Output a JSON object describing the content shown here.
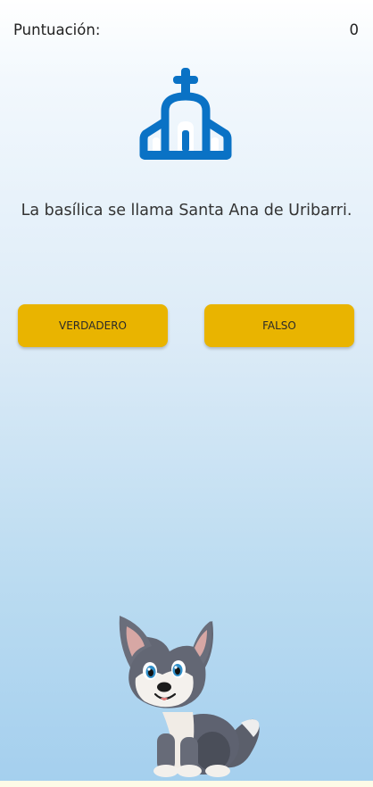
{
  "score": {
    "label": "Puntuación:",
    "value": "0"
  },
  "question": {
    "icon": "church-icon",
    "text": "La basílica se llama Santa Ana de Uribarri."
  },
  "answers": {
    "true_label": "VERDADERO",
    "false_label": "FALSO"
  },
  "mascot": {
    "icon": "wolf-pup-mascot"
  },
  "colors": {
    "accent": "#e9b400",
    "icon": "#0a72c5",
    "background_top": "#ffffff",
    "background_bottom": "#a4cfee"
  }
}
